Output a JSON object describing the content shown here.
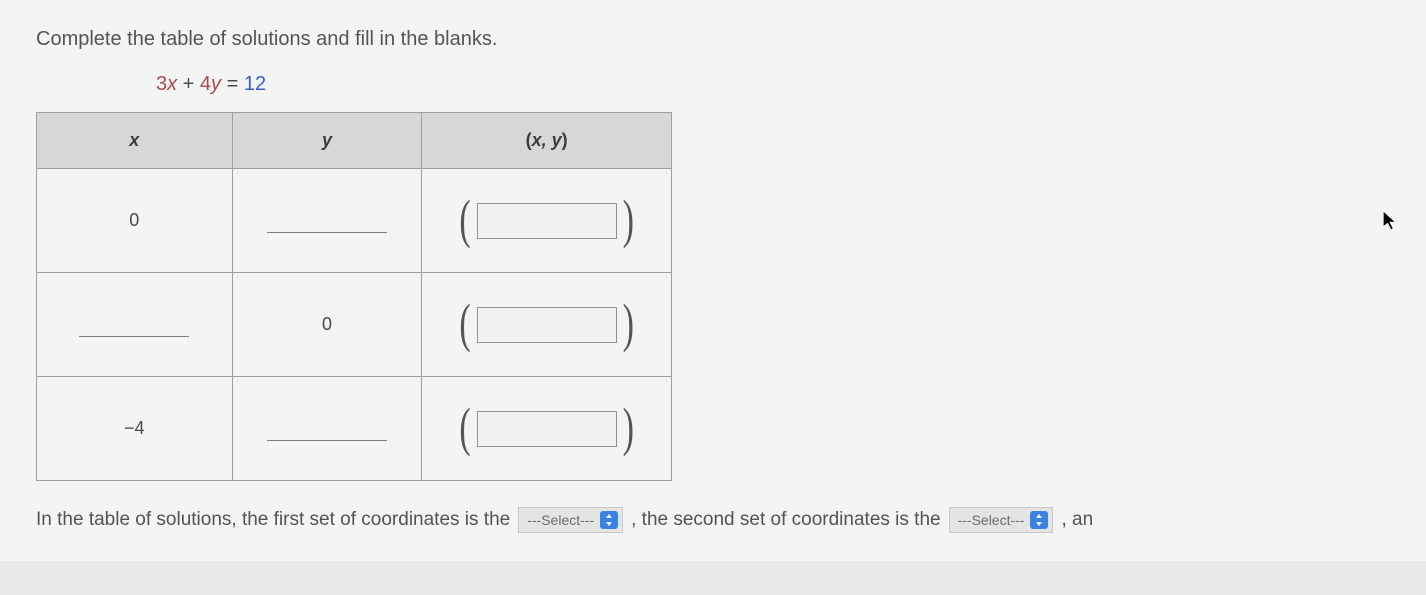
{
  "instruction": "Complete the table of solutions and fill in the blanks.",
  "equation": {
    "coef1": "3",
    "var1": "x",
    "plus": " + ",
    "coef2": "4",
    "var2": "y",
    "eq": " = ",
    "rhs": "12"
  },
  "table": {
    "headers": {
      "x": "x",
      "y": "y",
      "xy_open": "(",
      "xy_vars": "x, y",
      "xy_close": ")"
    },
    "rows": [
      {
        "x": "0",
        "y_blank": true
      },
      {
        "x_blank": true,
        "y": "0"
      },
      {
        "x": "−4",
        "y_blank": true
      }
    ]
  },
  "sentence": {
    "p1": "In the table of solutions, the first set of coordinates is the",
    "select_label": "---Select---",
    "p2": ", the second set of coordinates is the",
    "p3": ", an"
  }
}
